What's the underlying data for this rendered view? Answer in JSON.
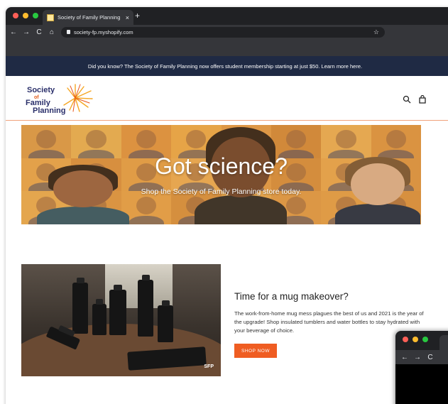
{
  "browser": {
    "tab_title": "Society of Family Planning",
    "tab_close": "×",
    "new_tab": "+",
    "url": "society-fp.myshopify.com",
    "back": "←",
    "forward": "→",
    "reload": "C",
    "home": "⌂",
    "bookmark_star": "☆",
    "traffic_colors": [
      "#ff5f57",
      "#febc2e",
      "#28c840"
    ]
  },
  "announcement": "Did you know? The Society of Family Planning now offers student membership starting at just $50. Learn more here.",
  "logo": {
    "line1": "Society",
    "line2": "of",
    "line3": "Family",
    "line4": "Planning"
  },
  "header_icons": [
    "search-icon",
    "cart-icon"
  ],
  "hero": {
    "title": "Got science?",
    "subtitle": "Shop the Society of Family Planning store today."
  },
  "feature": {
    "title": "Time for a mug makeover?",
    "body": "The work-from-home mug mess plagues the best of us and 2021 is the year of the upgrade! Shop insulated tumblers and water bottles to stay hydrated with your beverage of choice.",
    "button": "SHOP NOW",
    "image_badge": "SFP"
  },
  "colors": {
    "announcement_bg": "#1f2a44",
    "accent": "#ef5d22",
    "logo_navy": "#2a2f6a"
  },
  "second_window": {
    "back": "←",
    "forward": "→",
    "reload": "C"
  }
}
